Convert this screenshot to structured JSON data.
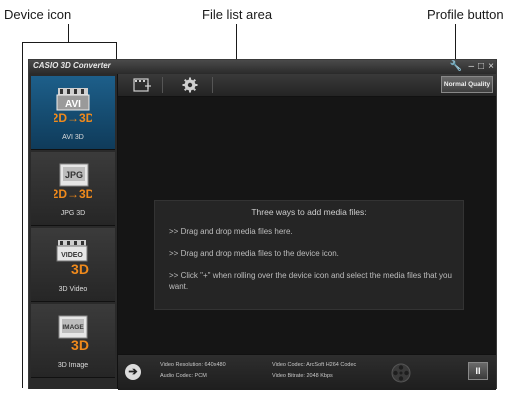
{
  "callouts": {
    "device_icon": "Device icon",
    "file_list_area": "File list area",
    "profile_button": "Profile button"
  },
  "window": {
    "title": "CASIO 3D Converter",
    "controls": {
      "settings": "🔧",
      "minimize": "–",
      "maximize": "□",
      "close": "×"
    }
  },
  "toolbar": {
    "add_icon": "film-add-icon",
    "settings_icon": "gear-icon",
    "profile_label": "Normal Quality"
  },
  "sidebar": {
    "items": [
      {
        "label": "AVI 3D",
        "badge": "AVI",
        "active": true
      },
      {
        "label": "JPG 3D",
        "badge": "JPG",
        "active": false
      },
      {
        "label": "3D Video",
        "badge": "VIDEO",
        "active": false
      },
      {
        "label": "3D Image",
        "badge": "IMAGE",
        "active": false
      }
    ]
  },
  "info": {
    "title": "Three ways to add media files:",
    "line1": ">>  Drag and drop media files here.",
    "line2": ">>  Drag and drop media files to the device icon.",
    "line3": ">>  Click \"+\" when rolling over the device icon and select the media files that you want."
  },
  "status": {
    "video_resolution": "Video Resolution: 640x480",
    "audio_codec": "Audio Codec: PCM",
    "video_codec": "Video Codec: ArcSoft H264 Codec",
    "video_bitrate": "Video Bitrate: 2048 Kbps",
    "pause_label": "II"
  },
  "colors": {
    "accent_blue": "#1d5f8a",
    "icon_orange": "#f08a1c",
    "background_dark": "#151515"
  }
}
